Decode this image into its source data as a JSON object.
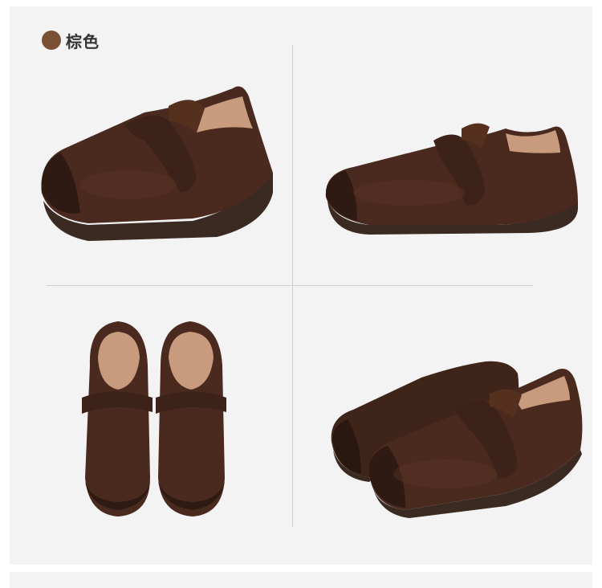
{
  "color_option": {
    "label": "棕色",
    "swatch_color": "#7a5035"
  },
  "product": {
    "leather_color": "#4a2a1e",
    "sole_color": "#3a2a22",
    "lining_color": "#c89a7e"
  },
  "photos": [
    {
      "icon": "shoe-side-angle-left"
    },
    {
      "icon": "shoe-side-angle-right"
    },
    {
      "icon": "shoe-pair-top-view"
    },
    {
      "icon": "shoe-pair-three-quarter"
    }
  ]
}
